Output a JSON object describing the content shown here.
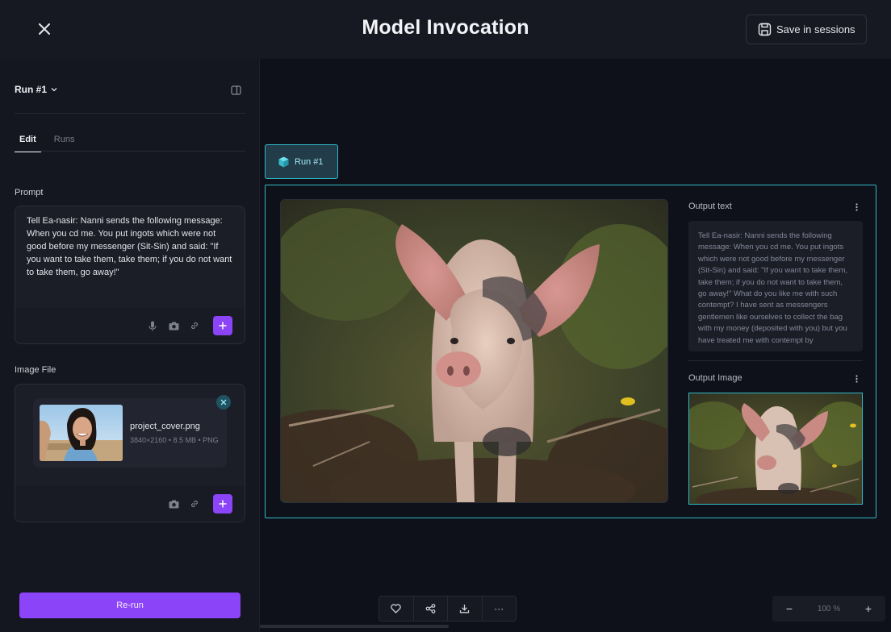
{
  "header": {
    "title": "Model Invocation",
    "save_label": "Save in sessions"
  },
  "sidebar": {
    "run_label": "Run #1",
    "tabs": [
      {
        "label": "Edit",
        "active": true
      },
      {
        "label": "Runs",
        "active": false
      }
    ],
    "prompt": {
      "label": "Prompt",
      "value": "Tell Ea-nasir: Nanni sends the following message: When you cd me. You put ingots which were not good before my messenger (Sit-Sin) and said: \"If you want to take them, take them; if you do not want to take them, go away!\""
    },
    "image_file": {
      "label": "Image File",
      "file_name": "project_cover.png",
      "file_meta": "3840×2160 • 8.5 MB • PNG"
    },
    "rerun_label": "Re-run"
  },
  "canvas": {
    "run_chip_label": "Run #1",
    "output_text_label": "Output text",
    "output_text": "Tell Ea-nasir: Nanni sends the following message:  When you cd me. You put ingots which were not good before my messenger (Sit-Sin) and said: \"If you want to take them, take them; if you do not want to take them, go away!\"  What do you  like me with such contempt? I have sent as messengers gentlemen like ourselves to collect the bag with my money (deposited with you) but you have treated me with contempt by",
    "output_image_label": "Output Image",
    "zoom_value": "100 %",
    "zoom_minus": "−",
    "zoom_plus": "+",
    "more_label": "···"
  },
  "colors": {
    "accent_purple": "#8b44f7",
    "accent_cyan": "#2fb8c6",
    "background": "#0f111a"
  }
}
